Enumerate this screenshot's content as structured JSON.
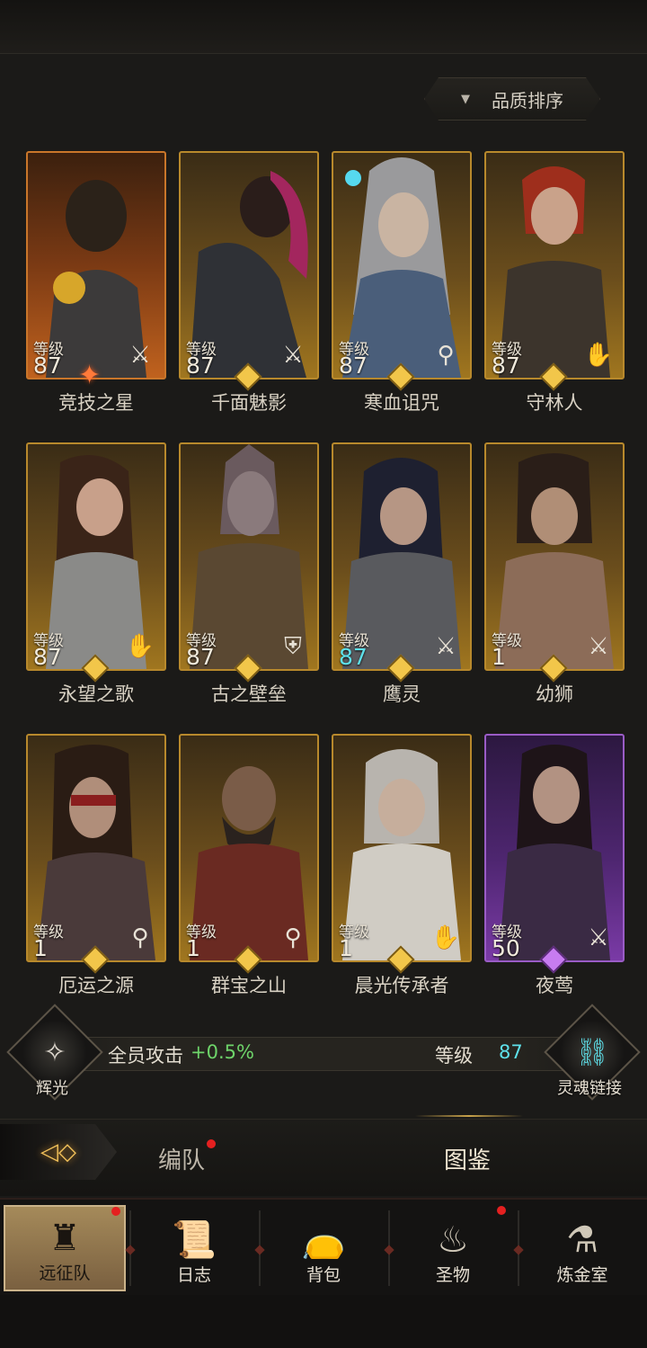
{
  "sort": {
    "arrow": "▼",
    "label": "品质排序"
  },
  "level_label": "等级",
  "heroes": [
    {
      "name": "竞技之星",
      "level": "87",
      "class_icon": "sword-icon",
      "rarity": "orange",
      "star": true
    },
    {
      "name": "千面魅影",
      "level": "87",
      "class_icon": "sword-icon",
      "rarity": "gold"
    },
    {
      "name": "寒血诅咒",
      "level": "87",
      "class_icon": "staff-icon",
      "rarity": "gold"
    },
    {
      "name": "守林人",
      "level": "87",
      "class_icon": "hand-icon",
      "rarity": "gold"
    },
    {
      "name": "永望之歌",
      "level": "87",
      "class_icon": "hand-icon",
      "rarity": "gold"
    },
    {
      "name": "古之壁垒",
      "level": "87",
      "class_icon": "shield-icon",
      "rarity": "gold"
    },
    {
      "name": "鹰灵",
      "level": "87",
      "class_icon": "sword-icon",
      "rarity": "gold",
      "level_color": "#5ee0ea"
    },
    {
      "name": "幼狮",
      "level": "1",
      "class_icon": "sword-icon",
      "rarity": "gold"
    },
    {
      "name": "厄运之源",
      "level": "1",
      "class_icon": "staff-icon",
      "rarity": "gold"
    },
    {
      "name": "群宝之山",
      "level": "1",
      "class_icon": "staff-icon",
      "rarity": "gold"
    },
    {
      "name": "晨光传承者",
      "level": "1",
      "class_icon": "hand-icon",
      "rarity": "gold"
    },
    {
      "name": "夜莺",
      "level": "50",
      "class_icon": "sword-icon",
      "rarity": "purple"
    }
  ],
  "radiance": {
    "label": "辉光",
    "bonus_label": "全员攻击",
    "bonus_value": "+0.5%"
  },
  "soul_link": {
    "label": "灵魂链接",
    "level_label": "等级",
    "level_value": "87"
  },
  "tabs": [
    {
      "label": "编队",
      "has_dot": true
    },
    {
      "label": "图鉴",
      "active": true
    }
  ],
  "nav": [
    {
      "label": "远征队",
      "icon": "helmet-icon",
      "active": true,
      "has_dot": true
    },
    {
      "label": "日志",
      "icon": "journal-icon"
    },
    {
      "label": "背包",
      "icon": "bag-icon"
    },
    {
      "label": "圣物",
      "icon": "torch-icon",
      "has_dot": true
    },
    {
      "label": "炼金室",
      "icon": "alchemy-icon"
    }
  ],
  "colors": {
    "gold_border": "#b8892c",
    "orange_border": "#c9762a",
    "purple_border": "#9a5cc6",
    "accent_cyan": "#5ee0ea",
    "accent_green": "#6ed46a",
    "notification_red": "#e42020"
  }
}
